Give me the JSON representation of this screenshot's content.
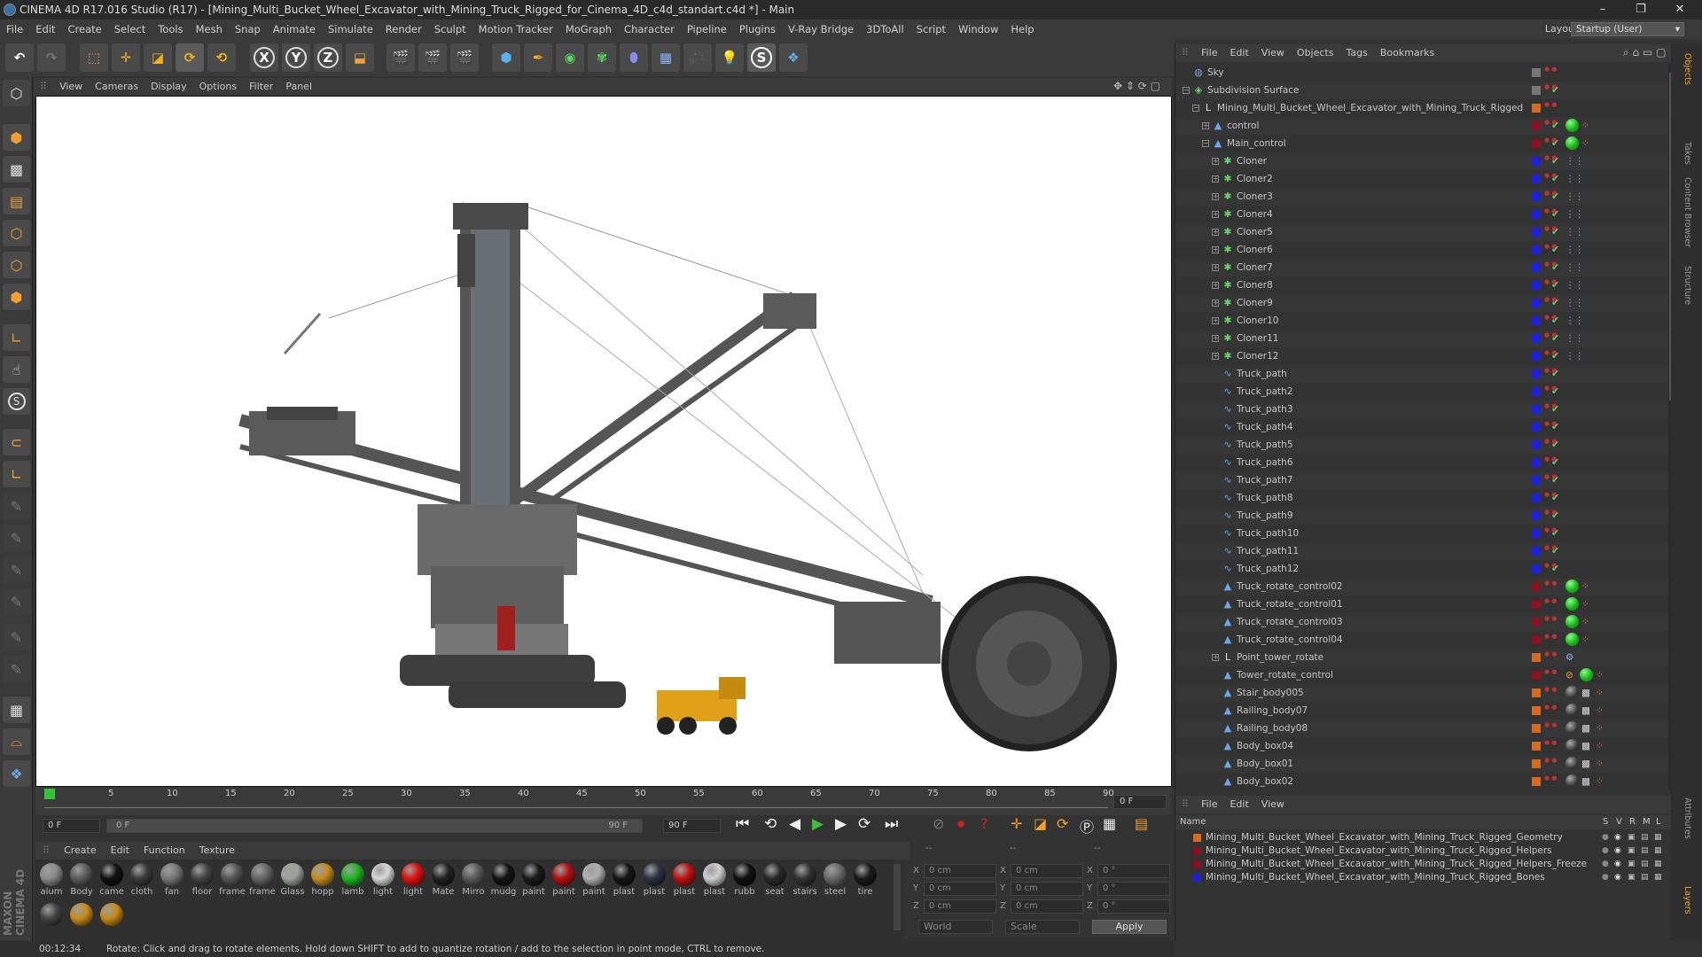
{
  "window": {
    "title": "CINEMA 4D R17.016 Studio (R17) - [Mining_Multi_Bucket_Wheel_Excavator_with_Mining_Truck_Rigged_for_Cinema_4D_c4d_standart.c4d *] - Main",
    "minimize": "–",
    "restore": "❐",
    "close": "✕"
  },
  "menu": [
    "File",
    "Edit",
    "Create",
    "Select",
    "Tools",
    "Mesh",
    "Snap",
    "Animate",
    "Simulate",
    "Render",
    "Sculpt",
    "Motion Tracker",
    "MoGraph",
    "Character",
    "Pipeline",
    "Plugins",
    "V-Ray Bridge",
    "3DToAll",
    "Script",
    "Window",
    "Help"
  ],
  "layout": {
    "label": "Layout:",
    "value": "Startup (User)"
  },
  "toolbar": {
    "x": "X",
    "y": "Y",
    "z": "Z"
  },
  "viewport": {
    "menu": [
      "View",
      "Cameras",
      "Display",
      "Options",
      "Filter",
      "Panel"
    ]
  },
  "timeline": {
    "ticks": [
      "0",
      "5",
      "10",
      "15",
      "20",
      "25",
      "30",
      "35",
      "40",
      "45",
      "50",
      "55",
      "60",
      "65",
      "70",
      "75",
      "80",
      "85",
      "90"
    ],
    "current": "0 F",
    "start": "0 F",
    "slider_left": "0 F",
    "slider_right": "90 F",
    "end": "90 F"
  },
  "materials": {
    "menu": [
      "Create",
      "Edit",
      "Function",
      "Texture"
    ],
    "items": [
      {
        "name": "alum",
        "color": "#8a8a8a"
      },
      {
        "name": "Body",
        "color": "#5a5a5a"
      },
      {
        "name": "came",
        "color": "#111111"
      },
      {
        "name": "cloth",
        "color": "#3a3a3a"
      },
      {
        "name": "fan",
        "color": "#777777"
      },
      {
        "name": "floor",
        "color": "#444444"
      },
      {
        "name": "frame",
        "color": "#555555"
      },
      {
        "name": "frame",
        "color": "#666666"
      },
      {
        "name": "Glass",
        "color": "#9aa39a"
      },
      {
        "name": "hopp",
        "color": "#c78a1d"
      },
      {
        "name": "lamb",
        "color": "#1fb51f"
      },
      {
        "name": "light",
        "color": "#d8d8d8"
      },
      {
        "name": "light",
        "color": "#e01010"
      },
      {
        "name": "Mate",
        "color": "#222222"
      },
      {
        "name": "Mirro",
        "color": "#5a5a5a"
      },
      {
        "name": "mudg",
        "color": "#151515"
      },
      {
        "name": "paint",
        "color": "#1a1a1a"
      },
      {
        "name": "paint",
        "color": "#b01010"
      },
      {
        "name": "paint",
        "color": "#b0b0b0"
      },
      {
        "name": "plast",
        "color": "#161616"
      },
      {
        "name": "plast",
        "color": "#2a3244"
      },
      {
        "name": "plast",
        "color": "#c01010"
      },
      {
        "name": "plast",
        "color": "#cfcfcf"
      },
      {
        "name": "rubb",
        "color": "#101010"
      },
      {
        "name": "seat",
        "color": "#2a2a2a"
      },
      {
        "name": "stairs",
        "color": "#333333"
      },
      {
        "name": "steel",
        "color": "#6a6a6a"
      },
      {
        "name": "tire",
        "color": "#1a1a1a"
      },
      {
        "name": "",
        "color": "#444444"
      },
      {
        "name": "",
        "color": "#c88a1a"
      },
      {
        "name": "",
        "color": "#c88a1a"
      }
    ]
  },
  "coords": {
    "rows": [
      {
        "a": "X",
        "av": "0 cm",
        "b": "X",
        "bv": "0 cm",
        "c": "X",
        "cv": "0 °"
      },
      {
        "a": "Y",
        "av": "0 cm",
        "b": "Y",
        "bv": "0 cm",
        "c": "Y",
        "cv": "0 °"
      },
      {
        "a": "Z",
        "av": "0 cm",
        "b": "Z",
        "bv": "0 cm",
        "c": "Z",
        "cv": "0 °"
      }
    ],
    "head": [
      "--",
      "--",
      "--"
    ],
    "world": "World",
    "scale": "Scale",
    "apply": "Apply"
  },
  "status": {
    "time": "00:12:34",
    "message": "Rotate: Click and drag to rotate elements. Hold down SHIFT to add to quantize rotation / add to the selection in point mode, CTRL to remove."
  },
  "objects": {
    "menu": [
      "File",
      "Edit",
      "View",
      "Objects",
      "Tags",
      "Bookmarks"
    ],
    "rows": [
      {
        "name": "Sky",
        "indent": 0,
        "icon": "◍",
        "ic": "#7aa7d8",
        "sw": "#777",
        "exp": ""
      },
      {
        "name": "Subdivision Surface",
        "indent": 0,
        "icon": "◈",
        "ic": "#6ccf6c",
        "sw": "#777",
        "exp": "−",
        "check": true
      },
      {
        "name": "Mining_Multi_Bucket_Wheel_Excavator_with_Mining_Truck_Rigged",
        "indent": 1,
        "icon": "L",
        "ic": "#ddd",
        "sw": "#d86a20",
        "exp": "−"
      },
      {
        "name": "control",
        "indent": 2,
        "icon": "▲",
        "ic": "#6aa8e8",
        "sw": "#8a1020",
        "exp": "+",
        "check": true,
        "tag": "green"
      },
      {
        "name": "Main_control",
        "indent": 2,
        "icon": "▲",
        "ic": "#6aa8e8",
        "sw": "#8a1020",
        "exp": "−",
        "check": true,
        "tag": "green"
      },
      {
        "name": "Cloner",
        "indent": 3,
        "icon": "✱",
        "ic": "#6ccf6c",
        "sw": "#2020d8",
        "exp": "+",
        "check": true,
        "tag": "dots"
      },
      {
        "name": "Cloner2",
        "indent": 3,
        "icon": "✱",
        "ic": "#6ccf6c",
        "sw": "#2020d8",
        "exp": "+",
        "check": true,
        "tag": "dots"
      },
      {
        "name": "Cloner3",
        "indent": 3,
        "icon": "✱",
        "ic": "#6ccf6c",
        "sw": "#2020d8",
        "exp": "+",
        "check": true,
        "tag": "dots"
      },
      {
        "name": "Cloner4",
        "indent": 3,
        "icon": "✱",
        "ic": "#6ccf6c",
        "sw": "#2020d8",
        "exp": "+",
        "check": true,
        "tag": "dots"
      },
      {
        "name": "Cloner5",
        "indent": 3,
        "icon": "✱",
        "ic": "#6ccf6c",
        "sw": "#2020d8",
        "exp": "+",
        "check": true,
        "tag": "dots"
      },
      {
        "name": "Cloner6",
        "indent": 3,
        "icon": "✱",
        "ic": "#6ccf6c",
        "sw": "#2020d8",
        "exp": "+",
        "check": true,
        "tag": "dots"
      },
      {
        "name": "Cloner7",
        "indent": 3,
        "icon": "✱",
        "ic": "#6ccf6c",
        "sw": "#2020d8",
        "exp": "+",
        "check": true,
        "tag": "dots"
      },
      {
        "name": "Cloner8",
        "indent": 3,
        "icon": "✱",
        "ic": "#6ccf6c",
        "sw": "#2020d8",
        "exp": "+",
        "check": true,
        "tag": "dots"
      },
      {
        "name": "Cloner9",
        "indent": 3,
        "icon": "✱",
        "ic": "#6ccf6c",
        "sw": "#2020d8",
        "exp": "+",
        "check": true,
        "tag": "dots"
      },
      {
        "name": "Cloner10",
        "indent": 3,
        "icon": "✱",
        "ic": "#6ccf6c",
        "sw": "#2020d8",
        "exp": "+",
        "check": true,
        "tag": "dots"
      },
      {
        "name": "Cloner11",
        "indent": 3,
        "icon": "✱",
        "ic": "#6ccf6c",
        "sw": "#2020d8",
        "exp": "+",
        "check": true,
        "tag": "dots"
      },
      {
        "name": "Cloner12",
        "indent": 3,
        "icon": "✱",
        "ic": "#6ccf6c",
        "sw": "#2020d8",
        "exp": "+",
        "check": true,
        "tag": "dots"
      },
      {
        "name": "Truck_path",
        "indent": 3,
        "icon": "∿",
        "ic": "#6aa8e8",
        "sw": "#2020d8",
        "exp": "",
        "check": true
      },
      {
        "name": "Truck_path2",
        "indent": 3,
        "icon": "∿",
        "ic": "#6aa8e8",
        "sw": "#2020d8",
        "exp": "",
        "check": true
      },
      {
        "name": "Truck_path3",
        "indent": 3,
        "icon": "∿",
        "ic": "#6aa8e8",
        "sw": "#2020d8",
        "exp": "",
        "check": true
      },
      {
        "name": "Truck_path4",
        "indent": 3,
        "icon": "∿",
        "ic": "#6aa8e8",
        "sw": "#2020d8",
        "exp": "",
        "check": true
      },
      {
        "name": "Truck_path5",
        "indent": 3,
        "icon": "∿",
        "ic": "#6aa8e8",
        "sw": "#2020d8",
        "exp": "",
        "check": true
      },
      {
        "name": "Truck_path6",
        "indent": 3,
        "icon": "∿",
        "ic": "#6aa8e8",
        "sw": "#2020d8",
        "exp": "",
        "check": true
      },
      {
        "name": "Truck_path7",
        "indent": 3,
        "icon": "∿",
        "ic": "#6aa8e8",
        "sw": "#2020d8",
        "exp": "",
        "check": true
      },
      {
        "name": "Truck_path8",
        "indent": 3,
        "icon": "∿",
        "ic": "#6aa8e8",
        "sw": "#2020d8",
        "exp": "",
        "check": true
      },
      {
        "name": "Truck_path9",
        "indent": 3,
        "icon": "∿",
        "ic": "#6aa8e8",
        "sw": "#2020d8",
        "exp": "",
        "check": true
      },
      {
        "name": "Truck_path10",
        "indent": 3,
        "icon": "∿",
        "ic": "#6aa8e8",
        "sw": "#2020d8",
        "exp": "",
        "check": true
      },
      {
        "name": "Truck_path11",
        "indent": 3,
        "icon": "∿",
        "ic": "#6aa8e8",
        "sw": "#2020d8",
        "exp": "",
        "check": true
      },
      {
        "name": "Truck_path12",
        "indent": 3,
        "icon": "∿",
        "ic": "#6aa8e8",
        "sw": "#2020d8",
        "exp": "",
        "check": true
      },
      {
        "name": "Truck_rotate_control02",
        "indent": 3,
        "icon": "▲",
        "ic": "#6aa8e8",
        "sw": "#8a1020",
        "exp": "",
        "tag": "green"
      },
      {
        "name": "Truck_rotate_control01",
        "indent": 3,
        "icon": "▲",
        "ic": "#6aa8e8",
        "sw": "#8a1020",
        "exp": "",
        "tag": "green"
      },
      {
        "name": "Truck_rotate_control03",
        "indent": 3,
        "icon": "▲",
        "ic": "#6aa8e8",
        "sw": "#8a1020",
        "exp": "",
        "tag": "green"
      },
      {
        "name": "Truck_rotate_control04",
        "indent": 3,
        "icon": "▲",
        "ic": "#6aa8e8",
        "sw": "#8a1020",
        "exp": "",
        "tag": "green"
      },
      {
        "name": "Point_tower_rotate",
        "indent": 3,
        "icon": "L",
        "ic": "#ddd",
        "sw": "#d86a20",
        "exp": "+",
        "tag": "ik"
      },
      {
        "name": "Tower_rotate_control",
        "indent": 3,
        "icon": "▲",
        "ic": "#6aa8e8",
        "sw": "#8a1020",
        "exp": "",
        "tag": "green2"
      },
      {
        "name": "Stair_body005",
        "indent": 3,
        "icon": "▲",
        "ic": "#6aa8e8",
        "sw": "#d86a20",
        "exp": "",
        "tag": "mat"
      },
      {
        "name": "Railing_body07",
        "indent": 3,
        "icon": "▲",
        "ic": "#6aa8e8",
        "sw": "#d86a20",
        "exp": "",
        "tag": "mat"
      },
      {
        "name": "Railing_body08",
        "indent": 3,
        "icon": "▲",
        "ic": "#6aa8e8",
        "sw": "#d86a20",
        "exp": "",
        "tag": "mat"
      },
      {
        "name": "Body_box04",
        "indent": 3,
        "icon": "▲",
        "ic": "#6aa8e8",
        "sw": "#d86a20",
        "exp": "",
        "tag": "mat"
      },
      {
        "name": "Body_box01",
        "indent": 3,
        "icon": "▲",
        "ic": "#6aa8e8",
        "sw": "#d86a20",
        "exp": "",
        "tag": "mat"
      },
      {
        "name": "Body_box02",
        "indent": 3,
        "icon": "▲",
        "ic": "#6aa8e8",
        "sw": "#d86a20",
        "exp": "",
        "tag": "mat"
      }
    ]
  },
  "layers": {
    "menu": [
      "File",
      "Edit",
      "View"
    ],
    "cols": {
      "name": "Name",
      "s": "S",
      "v": "V",
      "r": "R",
      "m": "M",
      "l": "L"
    },
    "rows": [
      {
        "name": "Mining_Multi_Bucket_Wheel_Excavator_with_Mining_Truck_Rigged_Geometry",
        "color": "#d86a20"
      },
      {
        "name": "Mining_Multi_Bucket_Wheel_Excavator_with_Mining_Truck_Rigged_Helpers",
        "color": "#8a1020"
      },
      {
        "name": "Mining_Multi_Bucket_Wheel_Excavator_with_Mining_Truck_Rigged_Helpers_Freeze",
        "color": "#8a1020"
      },
      {
        "name": "Mining_Multi_Bucket_Wheel_Excavator_with_Mining_Truck_Rigged_Bones",
        "color": "#2020d8"
      }
    ]
  },
  "right_tabs": [
    "Objects",
    "Takes",
    "Content Browser",
    "Structure",
    "Attributes",
    "Layers"
  ],
  "brand": "MAXON CINEMA 4D"
}
